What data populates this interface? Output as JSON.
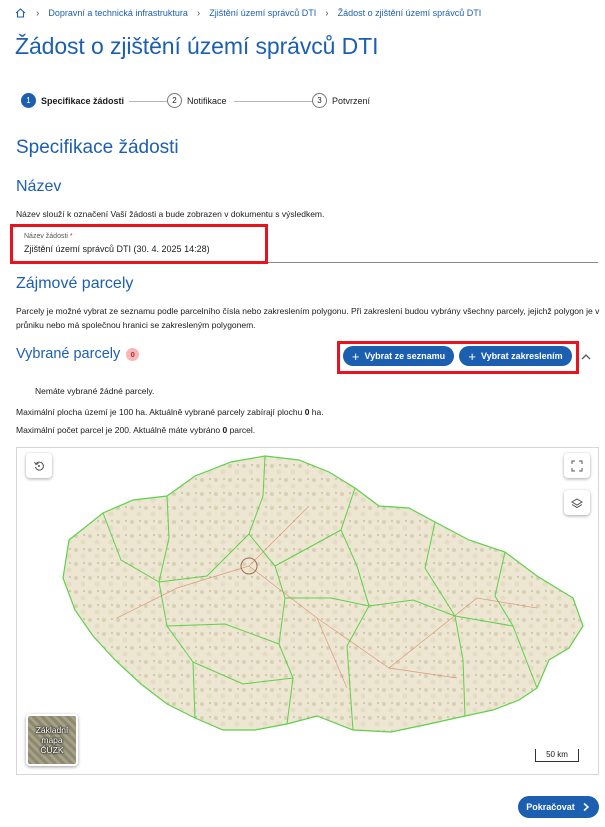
{
  "breadcrumb": {
    "items": [
      "Dopravní a technická infrastruktura",
      "Zjištění území správců DTI",
      "Žádost o zjištění území správců DTI"
    ]
  },
  "page_title": "Žádost o zjištění území správců DTI",
  "stepper": {
    "steps": [
      {
        "num": "1",
        "label": "Specifikace žádosti",
        "active": true
      },
      {
        "num": "2",
        "label": "Notifikace",
        "active": false
      },
      {
        "num": "3",
        "label": "Potvrzení",
        "active": false
      }
    ]
  },
  "spec": {
    "title": "Specifikace žádosti",
    "name_section": {
      "title": "Název",
      "description": "Název slouží k označení Vaší žádosti a bude zobrazen v dokumentu s výsledkem.",
      "field_label": "Název žádosti",
      "field_required_mark": "*",
      "field_value": "Zjištění území správců DTI (30. 4. 2025 14:28)"
    },
    "parcels": {
      "title": "Zájmové parcely",
      "description": "Parcely je možné vybrat ze seznamu podle parcelního čísla nebo zakreslením polygonu. Při zakreslení budou vybrány všechny parcely, jejichž polygon je v průniku nebo má společnou hranici se zakresleným polygonem.",
      "selected_title": "Vybrané parcely",
      "selected_count": "0",
      "btn_from_list": "Vybrat ze seznamu",
      "btn_by_drawing": "Vybrat zakreslením",
      "empty_message": "Nemáte vybrané žádné parcely.",
      "area_info_prefix": "Maximální plocha území je 100 ha. Aktuálně vybrané parcely zabírají plochu ",
      "area_value": "0",
      "area_unit": " ha.",
      "count_info_prefix": "Maximální počet parcel je 200. Aktuálně máte vybráno ",
      "count_value": "0",
      "count_unit": " parcel."
    }
  },
  "map": {
    "basemap_label_line1": "Základní",
    "basemap_label_line2": "mapa",
    "basemap_label_line3": "ČÚZK",
    "scale_label": "50 km"
  },
  "continue_label": "Pokračovat",
  "colors": {
    "accent": "#1c5fb0",
    "highlight": "#e5141e",
    "region_border": "#5fd04a"
  }
}
